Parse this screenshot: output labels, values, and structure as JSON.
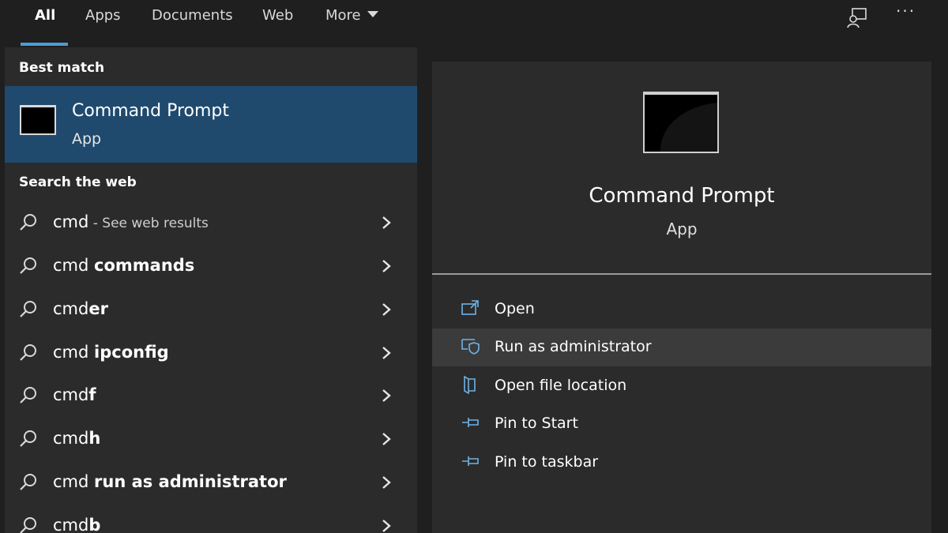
{
  "tabs": [
    {
      "label": "All",
      "active": true
    },
    {
      "label": "Apps"
    },
    {
      "label": "Documents"
    },
    {
      "label": "Web"
    },
    {
      "label": "More"
    }
  ],
  "top_icons": {
    "feedback": "feedback-icon",
    "more": "···"
  },
  "left": {
    "best_match_heading": "Best match",
    "best_match": {
      "title": "Command Prompt",
      "subtitle": "App",
      "icon": "command-prompt-icon"
    },
    "web_heading": "Search the web",
    "web_results": [
      {
        "prefix": "cmd",
        "bold": "",
        "hint": " - See web results"
      },
      {
        "prefix": "cmd ",
        "bold": "commands",
        "hint": ""
      },
      {
        "prefix": "cmd",
        "bold": "er",
        "hint": ""
      },
      {
        "prefix": "cmd ",
        "bold": "ipconfig",
        "hint": ""
      },
      {
        "prefix": "cmd",
        "bold": "f",
        "hint": ""
      },
      {
        "prefix": "cmd",
        "bold": "h",
        "hint": ""
      },
      {
        "prefix": "cmd ",
        "bold": "run as administrator",
        "hint": ""
      },
      {
        "prefix": "cmd",
        "bold": "b",
        "hint": ""
      }
    ]
  },
  "right": {
    "title": "Command Prompt",
    "subtitle": "App",
    "actions": [
      {
        "label": "Open",
        "icon": "open-icon"
      },
      {
        "label": "Run as administrator",
        "icon": "run-as-admin-icon",
        "highlighted": true
      },
      {
        "label": "Open file location",
        "icon": "file-location-icon"
      },
      {
        "label": "Pin to Start",
        "icon": "pin-icon"
      },
      {
        "label": "Pin to taskbar",
        "icon": "pin-icon"
      }
    ]
  },
  "colors": {
    "accent": "#4a9ddb",
    "selected": "#1f4a6e",
    "panel": "#2b2b2b",
    "background": "#1f1f1f"
  }
}
